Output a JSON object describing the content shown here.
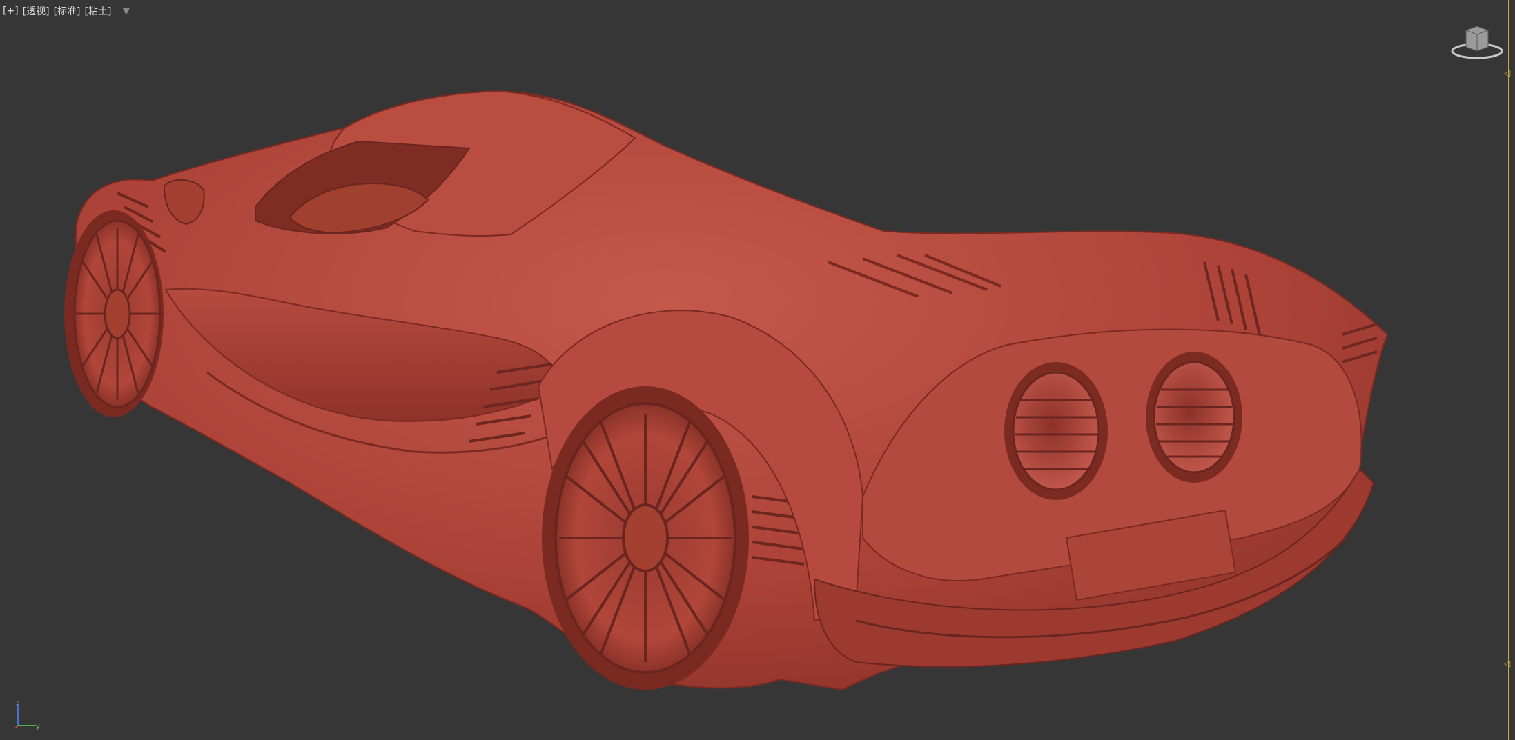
{
  "viewport": {
    "labels": [
      "[+]",
      "[透视]",
      "[标准]",
      "[粘土]"
    ],
    "filter_icon": "filter-funnel-icon",
    "background": "#363636",
    "model_color": "#b5473c",
    "edge_marker_color": "#d4b04c",
    "navcube_icon": "viewcube-icon",
    "axis": {
      "z": "z",
      "y": "y"
    }
  }
}
